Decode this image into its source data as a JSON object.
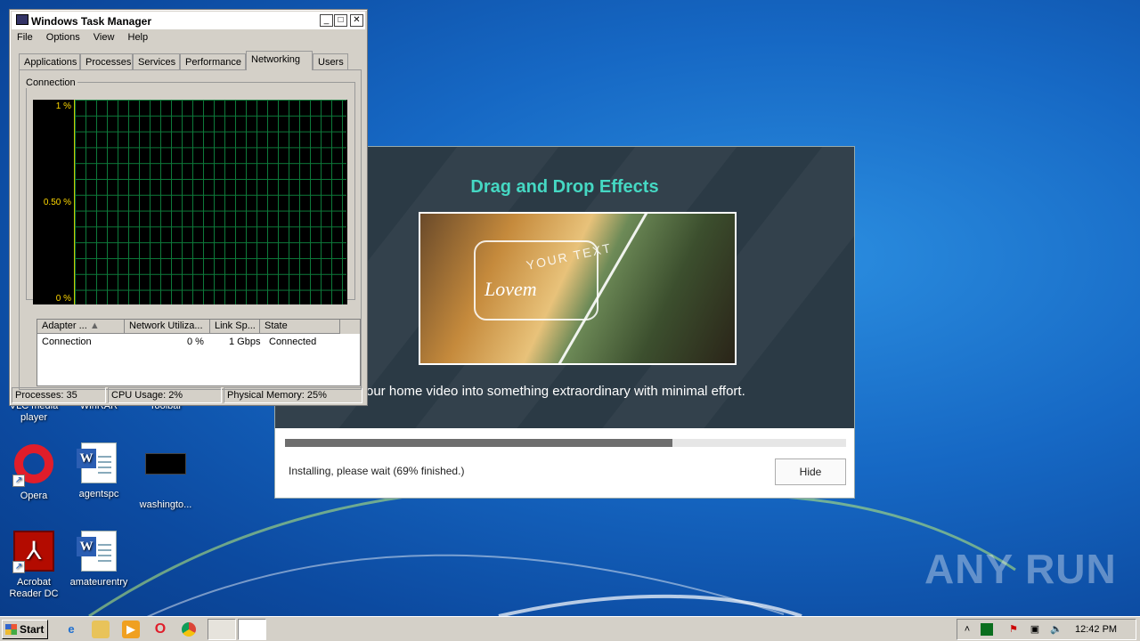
{
  "desktop": {
    "icons_top": [
      {
        "label_line1": "VLC media",
        "label_line2": "player"
      },
      {
        "label_line1": "WinRAR",
        "label_line2": ""
      },
      {
        "label_line1": "Toolbar",
        "label_line2": ""
      }
    ],
    "icons": [
      {
        "name": "opera",
        "label": "Opera",
        "icon": "opera-icon"
      },
      {
        "name": "agentspc",
        "label": "agentspc",
        "icon": "word-document-icon"
      },
      {
        "name": "washington",
        "label": "washingto...",
        "icon": "image-thumbnail-icon"
      },
      {
        "name": "acrobat",
        "label": "Acrobat Reader DC",
        "icon": "acrobat-icon"
      },
      {
        "name": "amateurentry",
        "label": "amateurentry",
        "icon": "word-document-icon"
      }
    ]
  },
  "installer": {
    "heading": "Drag and Drop Effects",
    "image_text_top": "YOUR TEXT",
    "image_text_script": "Lovem",
    "description": "our home video into something extraordinary with minimal effort.",
    "progress_fraction": 0.69,
    "status": "Installing, please wait (69% finished.)",
    "hide_label": "Hide",
    "accent_color": "#45d8c3"
  },
  "taskmgr": {
    "title": "Windows Task Manager",
    "menu": [
      "File",
      "Options",
      "View",
      "Help"
    ],
    "tabs": [
      "Applications",
      "Processes",
      "Services",
      "Performance",
      "Networking",
      "Users"
    ],
    "active_tab": "Networking",
    "group_label": "Connection",
    "graph_labels": {
      "top": "1 %",
      "mid": "0.50 %",
      "bottom": "0 %"
    },
    "columns": [
      "Adapter ...",
      "Network Utiliza...",
      "Link Sp...",
      "State"
    ],
    "rows": [
      {
        "adapter": "Connection",
        "utilization": "0 %",
        "link_speed": "1 Gbps",
        "state": "Connected"
      }
    ],
    "status": {
      "processes": "Processes: 35",
      "cpu": "CPU Usage: 2%",
      "memory": "Physical Memory: 25%"
    }
  },
  "watermark": "ANY RUN",
  "taskbar": {
    "start_label": "Start",
    "clock": "12:42 PM",
    "pinned": [
      "internet-explorer-icon",
      "explorer-icon",
      "media-player-icon",
      "opera-icon",
      "chrome-icon"
    ]
  }
}
